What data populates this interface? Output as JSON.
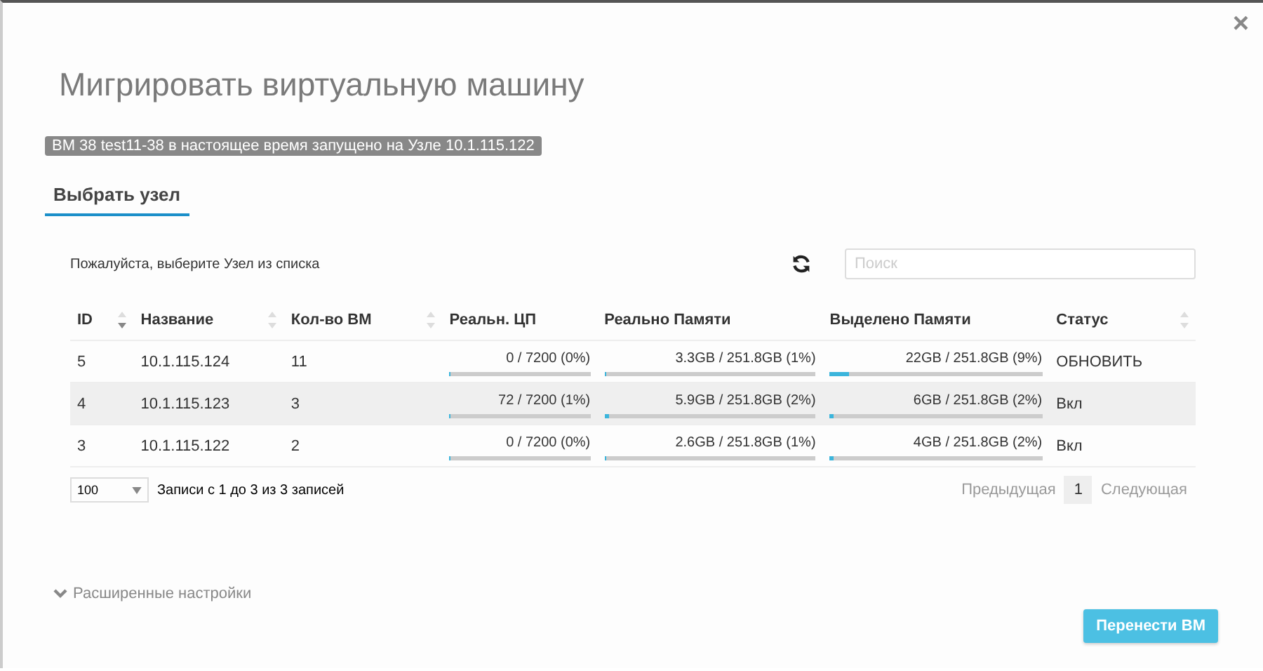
{
  "dialog": {
    "title": "Мигрировать виртуальную машину",
    "close": "×",
    "notice": "ВМ 38 test11-38 в настоящее время запущено на Узле 10.1.115.122"
  },
  "tabs": [
    {
      "label": "Выбрать узел",
      "selected": true
    }
  ],
  "hint": "Пожалуйста, выберите Узел из списка",
  "search": {
    "placeholder": "Поиск"
  },
  "table": {
    "columns": [
      {
        "label": "ID",
        "sortable": true,
        "sorted": true
      },
      {
        "label": "Название",
        "sortable": true,
        "sorted": false
      },
      {
        "label": "Кол-во ВМ",
        "sortable": true,
        "sorted": false
      },
      {
        "label": "Реальн. ЦП"
      },
      {
        "label": "Реально Памяти"
      },
      {
        "label": "Выделено Памяти"
      },
      {
        "label": "Статус",
        "sortable": true,
        "sorted": false
      }
    ],
    "rows": [
      {
        "selected": false,
        "id": "5",
        "name": "10.1.115.124",
        "vms": "11",
        "cpu": {
          "reading": "0 / 7200 (0%)",
          "level": 0
        },
        "mem": {
          "reading": "3.3GB / 251.8GB (1%)",
          "level": 0.01
        },
        "alloc": {
          "reading": "22GB / 251.8GB (9%)",
          "level": 0.09
        },
        "status": "ОБНОВИТЬ"
      },
      {
        "selected": true,
        "id": "4",
        "name": "10.1.115.123",
        "vms": "3",
        "cpu": {
          "reading": "72 / 7200 (1%)",
          "level": 0.01
        },
        "mem": {
          "reading": "5.9GB / 251.8GB (2%)",
          "level": 0.02
        },
        "alloc": {
          "reading": "6GB / 251.8GB (2%)",
          "level": 0.02
        },
        "status": "Вкл"
      },
      {
        "selected": false,
        "id": "3",
        "name": "10.1.115.122",
        "vms": "2",
        "cpu": {
          "reading": "0 / 7200 (0%)",
          "level": 0
        },
        "mem": {
          "reading": "2.6GB / 251.8GB (1%)",
          "level": 0.01
        },
        "alloc": {
          "reading": "4GB / 251.8GB (2%)",
          "level": 0.02
        },
        "status": "Вкл"
      }
    ]
  },
  "page_size": "100",
  "records_info": "Записи с 1 до 3 из 3 записей",
  "pagination": [
    {
      "label": "Предыдущая",
      "kind": "prev",
      "disabled": true
    },
    {
      "label": "1",
      "kind": "page",
      "selected": true
    },
    {
      "label": "Следующая",
      "kind": "next",
      "disabled": true
    }
  ],
  "advanced": "Расширенные настройки",
  "submit": "Перенести ВМ"
}
